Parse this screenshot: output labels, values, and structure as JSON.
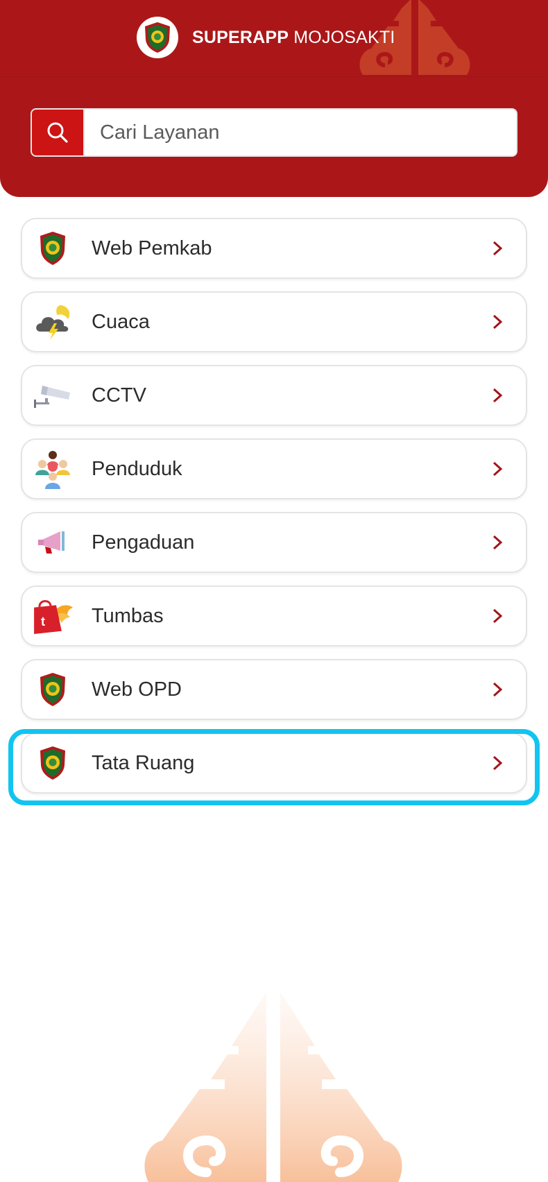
{
  "header": {
    "title_bold": "SUPERAPP",
    "title_regular": " MOJOSAKTI",
    "logo_icon": "mojokerto-emblem-icon"
  },
  "search": {
    "placeholder": "Cari Layanan",
    "button_icon": "search-icon"
  },
  "menu": {
    "items": [
      {
        "label": "Web Pemkab",
        "icon": "emblem-icon"
      },
      {
        "label": "Cuaca",
        "icon": "weather-storm-icon"
      },
      {
        "label": "CCTV",
        "icon": "cctv-camera-icon"
      },
      {
        "label": "Penduduk",
        "icon": "population-icon"
      },
      {
        "label": "Pengaduan",
        "icon": "megaphone-icon"
      },
      {
        "label": "Tumbas",
        "icon": "shopping-bag-icon"
      },
      {
        "label": "Web OPD",
        "icon": "emblem-icon"
      },
      {
        "label": "Tata Ruang",
        "icon": "emblem-icon"
      }
    ],
    "highlighted_item": "Tata Ruang"
  },
  "colors": {
    "brand_red": "#ab1719",
    "search_button_red": "#cc1414",
    "highlight_cyan": "#12c4f0",
    "chevron": "#a3151a"
  }
}
